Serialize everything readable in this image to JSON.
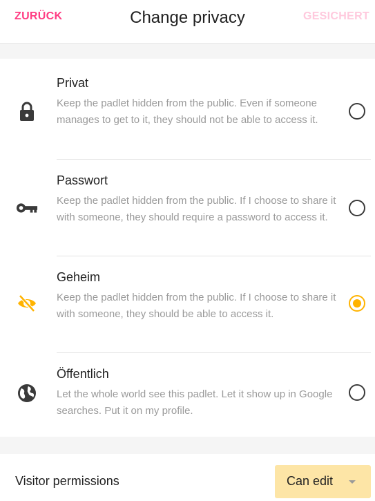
{
  "header": {
    "back_label": "ZURÜCK",
    "title": "Change privacy",
    "save_label": "GESICHERT"
  },
  "options": [
    {
      "title": "Privat",
      "description": "Keep the padlet hidden from the public. Even if someone manages to get to it, they should not be able to access it.",
      "icon": "lock-icon",
      "selected": false
    },
    {
      "title": "Passwort",
      "description": "Keep the padlet hidden from the public. If I choose to share it with someone, they should require a password to access it.",
      "icon": "key-icon",
      "selected": false
    },
    {
      "title": "Geheim",
      "description": "Keep the padlet hidden from the public. If I choose to share it with someone, they should be able to access it.",
      "icon": "eye-off-icon",
      "selected": true
    },
    {
      "title": "Öffentlich",
      "description": "Let the whole world see this padlet. Let it show up in Google searches. Put it on my profile.",
      "icon": "globe-icon",
      "selected": false
    }
  ],
  "visitor": {
    "label": "Visitor permissions",
    "value": "Can edit"
  },
  "colors": {
    "accent_pink": "#ff3d83",
    "disabled_pink": "#ffc9dd",
    "selected_yellow": "#ffb300",
    "select_bg": "#fde5a6"
  }
}
